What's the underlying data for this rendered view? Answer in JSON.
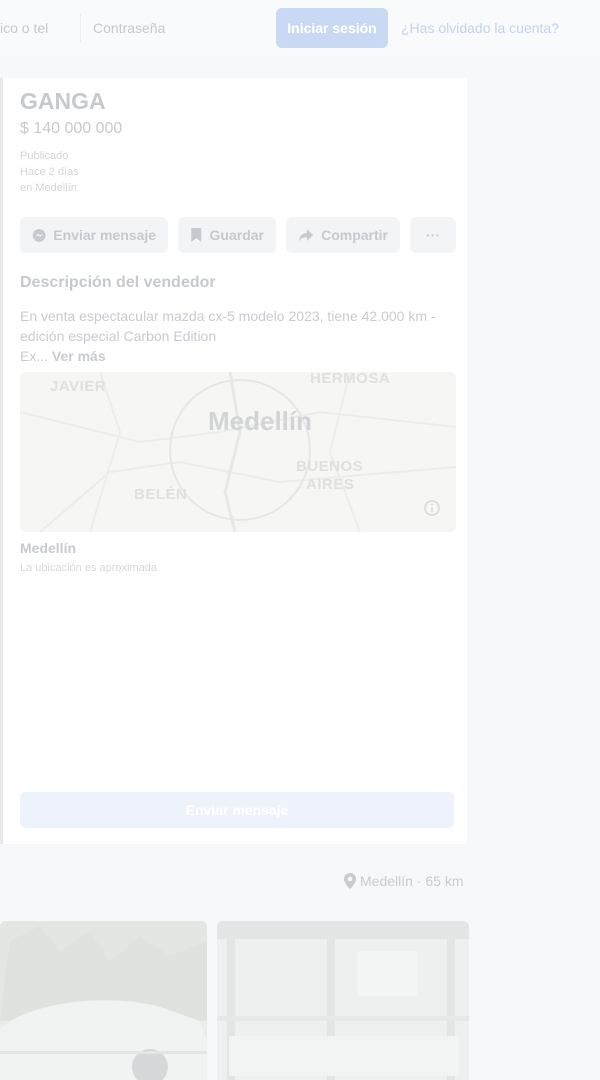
{
  "header": {
    "email_placeholder": "ico o tel",
    "password_placeholder": "Contraseña",
    "login_label": "Iniciar sesión",
    "forgot_label": "¿Has olvidado la cuenta?"
  },
  "listing": {
    "title": "GANGA",
    "price": "$ 140 000 000",
    "published_label": "Publicado",
    "published_ago": "Hace 2 días",
    "published_where": "en Medellín",
    "actions": {
      "message": "Enviar mensaje",
      "save": "Guardar",
      "share": "Compartir",
      "more": "···"
    },
    "description_title": "Descripción del vendedor",
    "description": "En venta espectacular mazda cx-5 modelo 2023, tiene 42.000 km - edición especial Carbon Edition",
    "description_tail": "Ex...",
    "see_more": "Ver más",
    "map": {
      "city": "Medellín",
      "labels": [
        "JAVIER",
        "HERMOSA",
        "BUENOS",
        "AIRES",
        "BELÉN"
      ]
    },
    "location_name": "Medellín",
    "location_note": "La ubicación es aproximada",
    "send_message": "Enviar mensaje"
  },
  "related": {
    "location_filter": "Medellín · 65 km"
  },
  "icons": {
    "message": "messenger-icon",
    "save": "bookmark-icon",
    "share": "share-arrow-icon",
    "more": "more-dots-icon",
    "info": "info-icon",
    "location": "location-pin-icon"
  }
}
